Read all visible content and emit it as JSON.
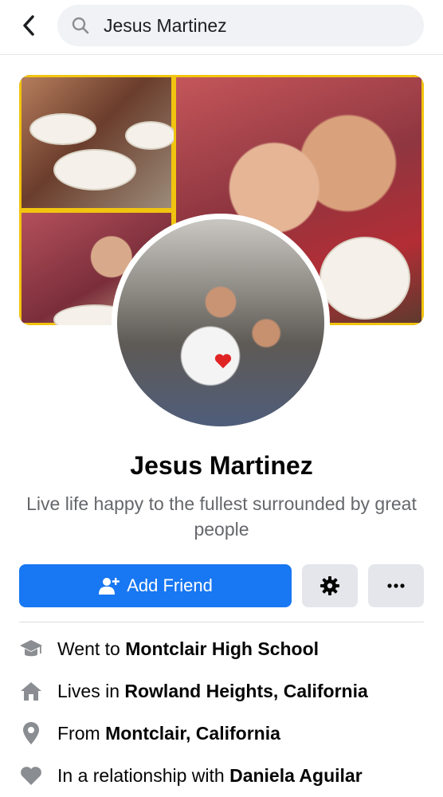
{
  "header": {
    "search_value": "Jesus Martinez"
  },
  "profile": {
    "name": "Jesus Martinez",
    "bio": "Live life happy to the fullest surrounded by great people"
  },
  "actions": {
    "add_friend_label": "Add Friend"
  },
  "intro": [
    {
      "prefix": "Went to ",
      "value": "Montclair High School",
      "icon": "graduation-cap-icon"
    },
    {
      "prefix": "Lives in ",
      "value": "Rowland Heights, California",
      "icon": "home-icon"
    },
    {
      "prefix": "From ",
      "value": "Montclair, California",
      "icon": "location-pin-icon"
    },
    {
      "prefix": "In a relationship with ",
      "value": "Daniela Aguilar",
      "icon": "heart-icon"
    }
  ],
  "colors": {
    "accent": "#1877f2",
    "icon_gray": "#8a8d91",
    "secondary_text": "#65676b"
  }
}
